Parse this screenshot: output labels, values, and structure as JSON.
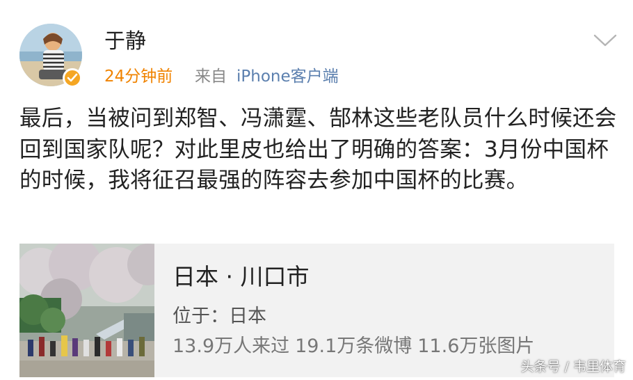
{
  "header": {
    "username": "于静",
    "time": "24分钟前",
    "source_prefix": "来自",
    "source_name": "iPhone客户端"
  },
  "post": {
    "text": "最后，当被问到郑智、冯潇霆、郜林这些老队员什么时候还会回到国家队呢？对此里皮也给出了明确的答案：3月份中国杯的时候，我将征召最强的阵容去参加中国杯的比赛。"
  },
  "location_card": {
    "title": "日本 · 川口市",
    "location": "位于：日本",
    "visitors": "13.9万人来过",
    "posts": "19.1万条微博",
    "photos": "11.6万张图片"
  },
  "watermark": "头条号 / 韦里体育",
  "icons": [
    "avatar",
    "verified-badge-icon",
    "chevron-down-icon"
  ],
  "colors": {
    "time": "#f08300",
    "source_link": "#5b7fae",
    "verified": "#f5a623",
    "card_bg": "#f2f2f2"
  }
}
